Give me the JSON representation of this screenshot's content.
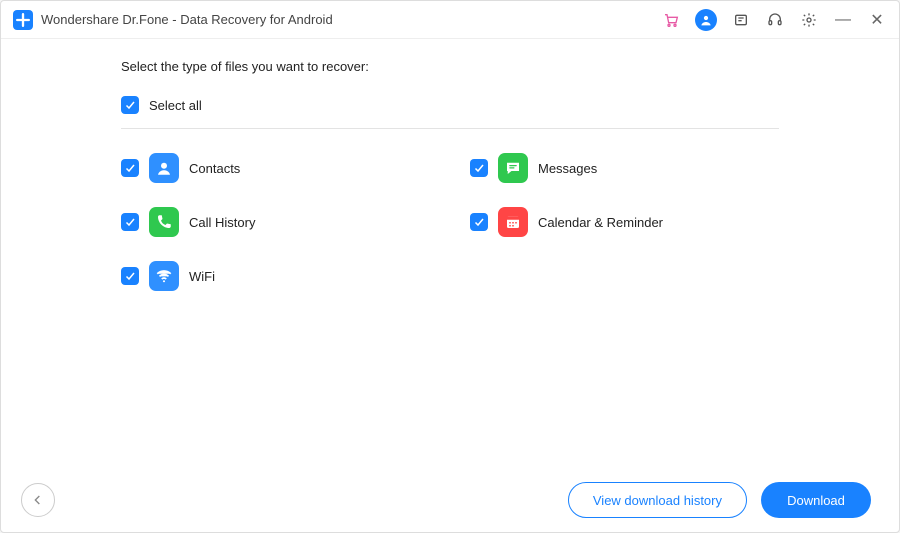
{
  "header": {
    "title": "Wondershare Dr.Fone - Data Recovery for Android"
  },
  "main": {
    "prompt": "Select the type of files you want to recover:",
    "select_all_label": "Select all",
    "file_types": [
      {
        "label": "Contacts",
        "icon": "contacts-icon",
        "color": "#2f90ff"
      },
      {
        "label": "Messages",
        "icon": "messages-icon",
        "color": "#2fc84f"
      },
      {
        "label": "Call History",
        "icon": "call-history-icon",
        "color": "#2fc84f"
      },
      {
        "label": "Calendar & Reminder",
        "icon": "calendar-icon",
        "color": "#ff4545"
      },
      {
        "label": "WiFi",
        "icon": "wifi-icon",
        "color": "#2f90ff"
      }
    ]
  },
  "footer": {
    "view_history_label": "View download history",
    "download_label": "Download"
  }
}
